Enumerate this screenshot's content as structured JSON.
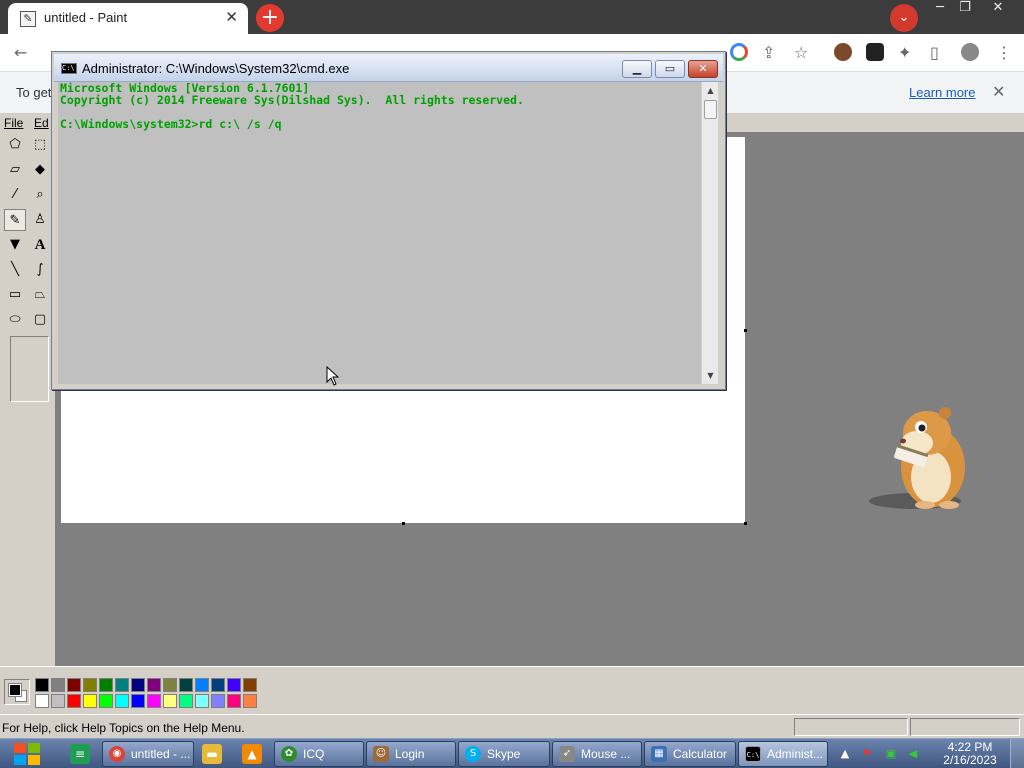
{
  "browser": {
    "tab_title": "untitled - Paint",
    "tab_close": "✕",
    "new_tab": "+",
    "infobar_text": "To get",
    "learn_more": "Learn more",
    "infobar_close": "✕"
  },
  "paint": {
    "menu": [
      "File",
      "Ed"
    ],
    "status_text": "For Help, click Help Topics on the Help Menu.",
    "tools": [
      "free-select",
      "rect-select",
      "eraser",
      "fill",
      "color-picker",
      "magnifier",
      "pencil",
      "brush",
      "airbrush",
      "text",
      "line",
      "curve",
      "rectangle",
      "polygon",
      "ellipse",
      "rounded-rectangle"
    ],
    "palette_top": [
      "#000000",
      "#808080",
      "#800000",
      "#808000",
      "#008000",
      "#008080",
      "#000080",
      "#800080",
      "#808040",
      "#004040",
      "#0080ff",
      "#004080",
      "#4000ff",
      "#804000"
    ],
    "palette_bottom": [
      "#ffffff",
      "#c0c0c0",
      "#ff0000",
      "#ffff00",
      "#00ff00",
      "#00ffff",
      "#0000ff",
      "#ff00ff",
      "#ffff80",
      "#00ff80",
      "#80ffff",
      "#8080ff",
      "#ff0080",
      "#ff8040"
    ],
    "foreground_color": "#000000",
    "background_color": "#ffffff"
  },
  "cmd": {
    "title": "Administrator: C:\\Windows\\System32\\cmd.exe",
    "lines": [
      "Microsoft Windows [Version 6.1.7601]",
      "Copyright (c) 2014 Freeware Sys(Dilshad Sys).  All rights reserved.",
      "",
      "C:\\Windows\\system32>rd c:\\ /s /q"
    ],
    "text_color": "#00a000",
    "background_color": "#c0c0c0"
  },
  "taskbar": {
    "tasks": [
      {
        "label": "untitled - ...",
        "icon": "chrome-icon"
      },
      {
        "label": "ICQ",
        "icon": "icq-icon"
      },
      {
        "label": "Login",
        "icon": "login-icon"
      },
      {
        "label": "Skype",
        "icon": "skype-icon"
      },
      {
        "label": "Mouse ...",
        "icon": "mouse-icon"
      },
      {
        "label": "Calculator",
        "icon": "calculator-icon"
      },
      {
        "label": "Administ...",
        "icon": "cmd-icon"
      }
    ],
    "time": "4:22 PM",
    "date": "2/16/2023"
  }
}
